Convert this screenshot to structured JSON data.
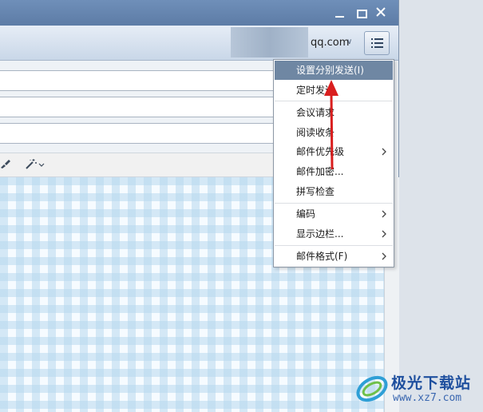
{
  "header": {
    "account_email": "qq.com"
  },
  "context_menu": {
    "items": [
      {
        "label": "设置分别发送(I)",
        "submenu": false,
        "active": true
      },
      {
        "label": "定时发送",
        "submenu": false
      },
      {
        "label": "会议请求",
        "submenu": false
      },
      {
        "label": "阅读收条",
        "submenu": false
      },
      {
        "label": "邮件优先级",
        "submenu": true
      },
      {
        "label": "邮件加密...",
        "submenu": false
      },
      {
        "label": "拼写检查",
        "submenu": false
      },
      {
        "label": "编码",
        "submenu": true
      },
      {
        "label": "显示边栏...",
        "submenu": true
      },
      {
        "label": "邮件格式(F)",
        "submenu": true
      }
    ]
  },
  "watermark": {
    "title": "极光下载站",
    "url": "www.xz7.com"
  },
  "colors": {
    "titlebar": "#5d7ca6",
    "menu_highlight": "#6f87a3",
    "annotation_arrow": "#d91e1e",
    "watermark": "#1e4f9e"
  },
  "icons": [
    "minimize-icon",
    "maximize-icon",
    "close-icon",
    "menu-list-icon",
    "chevron-down-icon",
    "brush-icon",
    "magic-wand-icon",
    "submenu-arrow-icon",
    "watermark-logo-icon"
  ]
}
